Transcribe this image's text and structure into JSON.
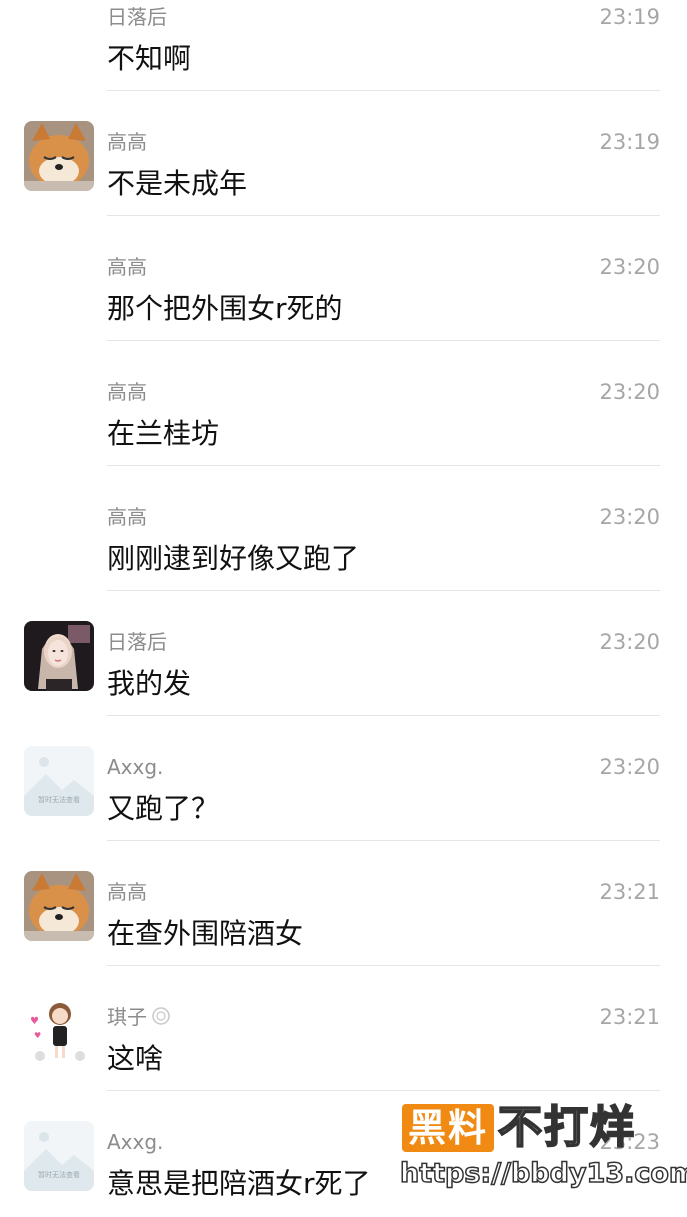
{
  "messages": [
    {
      "sender": "日落后",
      "time": "23:19",
      "text": "不知啊",
      "avatar": "none"
    },
    {
      "sender": "高高",
      "time": "23:19",
      "text": "不是未成年",
      "avatar": "shiba"
    },
    {
      "sender": "高高",
      "time": "23:20",
      "text": "那个把外围女r死的",
      "avatar": "none"
    },
    {
      "sender": "高高",
      "time": "23:20",
      "text": "在兰桂坊",
      "avatar": "none"
    },
    {
      "sender": "高高",
      "time": "23:20",
      "text": "刚刚逮到好像又跑了",
      "avatar": "none"
    },
    {
      "sender": "日落后",
      "time": "23:20",
      "text": "我的发",
      "avatar": "girl"
    },
    {
      "sender": "Axxg.",
      "time": "23:20",
      "text": "又跑了？",
      "avatar": "placeholder"
    },
    {
      "sender": "高高",
      "time": "23:21",
      "text": "在查外围陪酒女",
      "avatar": "shiba"
    },
    {
      "sender": "琪子",
      "time": "23:21",
      "text": "这啥",
      "avatar": "cartoon",
      "badge": "flower-badge-icon"
    },
    {
      "sender": "Axxg.",
      "time": "23:23",
      "text": "意思是把陪酒女r死了",
      "avatar": "placeholder"
    }
  ],
  "placeholder_avatar_caption": "暂时无法查看",
  "watermark": {
    "box": "黑料",
    "title": "不打烊",
    "url": "https://bbdy13.com"
  },
  "colors": {
    "sender": "#8c8c8c",
    "time": "#a6a6a6",
    "text": "#111111",
    "divider": "#e5e5e5",
    "watermark_orange": "#f08a12"
  }
}
